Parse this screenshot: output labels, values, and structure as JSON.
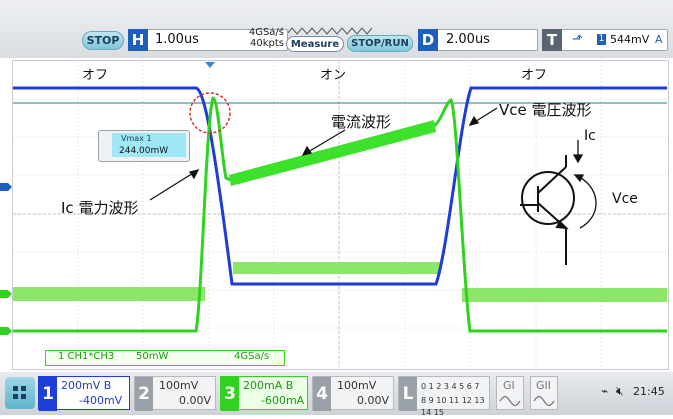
{
  "toolbar": {
    "stop_label": "STOP",
    "h_letter": "H",
    "timebase": "1.00us",
    "sample_rate": "4GSa/s",
    "points": "40kpts",
    "measure_label": "Measure",
    "stoprun_label": "STOP/RUN",
    "d_letter": "D",
    "delay": "2.00us",
    "t_letter": "T",
    "trigger_source": "1",
    "trigger_level": "544mV",
    "trigger_mode": "A"
  },
  "plot": {
    "region_labels": [
      "オフ",
      "オン",
      "オフ"
    ],
    "annotations": {
      "ic_power": "Ic 電力波形",
      "current_waveform": "電流波形",
      "vce_waveform": "Vce 電圧波形",
      "ic": "Ic",
      "vce": "Vce"
    },
    "vmax": {
      "label": "Vmax 1",
      "value": "244.00mW"
    },
    "math": {
      "label": "1 CH1*CH3",
      "scale": "50mW",
      "rate": "4GSa/s"
    }
  },
  "channels": [
    {
      "num": "1",
      "scale": "200mV",
      "bw": "B",
      "offset": "-400mV",
      "color": "#1e3cd6",
      "active": true
    },
    {
      "num": "2",
      "scale": "100mV",
      "bw": "",
      "offset": "0.00V",
      "color": "#8a8f96",
      "active": false
    },
    {
      "num": "3",
      "scale": "200mA",
      "bw": "B",
      "offset": "-600mA",
      "color": "#2fd31f",
      "active": true
    },
    {
      "num": "4",
      "scale": "100mV",
      "bw": "",
      "offset": "0.00V",
      "color": "#8a8f96",
      "active": false
    }
  ],
  "digital": {
    "letter": "L",
    "row1": "0 1 2 3 4 5 6 7",
    "row2": "8 9 10 11 12 13 14 15"
  },
  "generators": [
    "GI",
    "GII"
  ],
  "status": {
    "time": "21:45"
  },
  "colors": {
    "ch1": "#1e3cd6",
    "ch3": "#2fd31f",
    "accent": "#1e5ebd"
  }
}
